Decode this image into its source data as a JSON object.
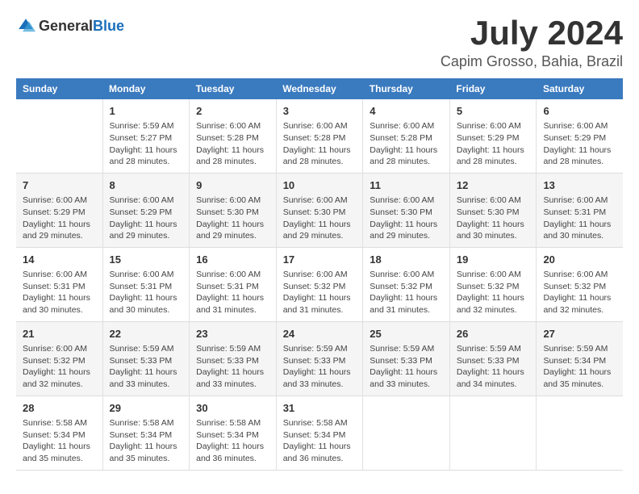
{
  "header": {
    "logo_general": "General",
    "logo_blue": "Blue",
    "title": "July 2024",
    "subtitle": "Capim Grosso, Bahia, Brazil"
  },
  "days_of_week": [
    "Sunday",
    "Monday",
    "Tuesday",
    "Wednesday",
    "Thursday",
    "Friday",
    "Saturday"
  ],
  "weeks": [
    [
      {
        "day": "",
        "content": ""
      },
      {
        "day": "1",
        "content": "Sunrise: 5:59 AM\nSunset: 5:27 PM\nDaylight: 11 hours\nand 28 minutes."
      },
      {
        "day": "2",
        "content": "Sunrise: 6:00 AM\nSunset: 5:28 PM\nDaylight: 11 hours\nand 28 minutes."
      },
      {
        "day": "3",
        "content": "Sunrise: 6:00 AM\nSunset: 5:28 PM\nDaylight: 11 hours\nand 28 minutes."
      },
      {
        "day": "4",
        "content": "Sunrise: 6:00 AM\nSunset: 5:28 PM\nDaylight: 11 hours\nand 28 minutes."
      },
      {
        "day": "5",
        "content": "Sunrise: 6:00 AM\nSunset: 5:29 PM\nDaylight: 11 hours\nand 28 minutes."
      },
      {
        "day": "6",
        "content": "Sunrise: 6:00 AM\nSunset: 5:29 PM\nDaylight: 11 hours\nand 28 minutes."
      }
    ],
    [
      {
        "day": "7",
        "content": "Sunrise: 6:00 AM\nSunset: 5:29 PM\nDaylight: 11 hours\nand 29 minutes."
      },
      {
        "day": "8",
        "content": "Sunrise: 6:00 AM\nSunset: 5:29 PM\nDaylight: 11 hours\nand 29 minutes."
      },
      {
        "day": "9",
        "content": "Sunrise: 6:00 AM\nSunset: 5:30 PM\nDaylight: 11 hours\nand 29 minutes."
      },
      {
        "day": "10",
        "content": "Sunrise: 6:00 AM\nSunset: 5:30 PM\nDaylight: 11 hours\nand 29 minutes."
      },
      {
        "day": "11",
        "content": "Sunrise: 6:00 AM\nSunset: 5:30 PM\nDaylight: 11 hours\nand 29 minutes."
      },
      {
        "day": "12",
        "content": "Sunrise: 6:00 AM\nSunset: 5:30 PM\nDaylight: 11 hours\nand 30 minutes."
      },
      {
        "day": "13",
        "content": "Sunrise: 6:00 AM\nSunset: 5:31 PM\nDaylight: 11 hours\nand 30 minutes."
      }
    ],
    [
      {
        "day": "14",
        "content": "Sunrise: 6:00 AM\nSunset: 5:31 PM\nDaylight: 11 hours\nand 30 minutes."
      },
      {
        "day": "15",
        "content": "Sunrise: 6:00 AM\nSunset: 5:31 PM\nDaylight: 11 hours\nand 30 minutes."
      },
      {
        "day": "16",
        "content": "Sunrise: 6:00 AM\nSunset: 5:31 PM\nDaylight: 11 hours\nand 31 minutes."
      },
      {
        "day": "17",
        "content": "Sunrise: 6:00 AM\nSunset: 5:32 PM\nDaylight: 11 hours\nand 31 minutes."
      },
      {
        "day": "18",
        "content": "Sunrise: 6:00 AM\nSunset: 5:32 PM\nDaylight: 11 hours\nand 31 minutes."
      },
      {
        "day": "19",
        "content": "Sunrise: 6:00 AM\nSunset: 5:32 PM\nDaylight: 11 hours\nand 32 minutes."
      },
      {
        "day": "20",
        "content": "Sunrise: 6:00 AM\nSunset: 5:32 PM\nDaylight: 11 hours\nand 32 minutes."
      }
    ],
    [
      {
        "day": "21",
        "content": "Sunrise: 6:00 AM\nSunset: 5:32 PM\nDaylight: 11 hours\nand 32 minutes."
      },
      {
        "day": "22",
        "content": "Sunrise: 5:59 AM\nSunset: 5:33 PM\nDaylight: 11 hours\nand 33 minutes."
      },
      {
        "day": "23",
        "content": "Sunrise: 5:59 AM\nSunset: 5:33 PM\nDaylight: 11 hours\nand 33 minutes."
      },
      {
        "day": "24",
        "content": "Sunrise: 5:59 AM\nSunset: 5:33 PM\nDaylight: 11 hours\nand 33 minutes."
      },
      {
        "day": "25",
        "content": "Sunrise: 5:59 AM\nSunset: 5:33 PM\nDaylight: 11 hours\nand 33 minutes."
      },
      {
        "day": "26",
        "content": "Sunrise: 5:59 AM\nSunset: 5:33 PM\nDaylight: 11 hours\nand 34 minutes."
      },
      {
        "day": "27",
        "content": "Sunrise: 5:59 AM\nSunset: 5:34 PM\nDaylight: 11 hours\nand 35 minutes."
      }
    ],
    [
      {
        "day": "28",
        "content": "Sunrise: 5:58 AM\nSunset: 5:34 PM\nDaylight: 11 hours\nand 35 minutes."
      },
      {
        "day": "29",
        "content": "Sunrise: 5:58 AM\nSunset: 5:34 PM\nDaylight: 11 hours\nand 35 minutes."
      },
      {
        "day": "30",
        "content": "Sunrise: 5:58 AM\nSunset: 5:34 PM\nDaylight: 11 hours\nand 36 minutes."
      },
      {
        "day": "31",
        "content": "Sunrise: 5:58 AM\nSunset: 5:34 PM\nDaylight: 11 hours\nand 36 minutes."
      },
      {
        "day": "",
        "content": ""
      },
      {
        "day": "",
        "content": ""
      },
      {
        "day": "",
        "content": ""
      }
    ]
  ]
}
